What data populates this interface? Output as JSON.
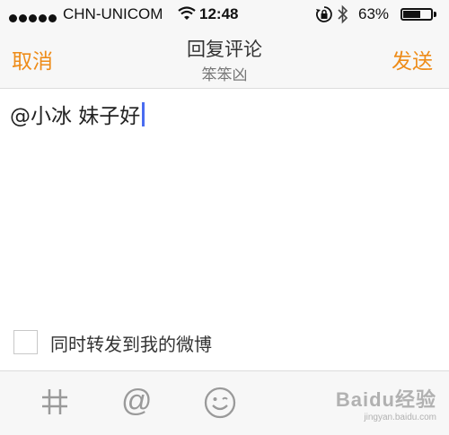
{
  "status_bar": {
    "carrier": "CHN-UNICOM",
    "time": "12:48",
    "battery_percent": "63%",
    "battery_level": 0.63,
    "icons": [
      "signal-dots-icon",
      "wifi-icon",
      "rotation-lock-icon",
      "bluetooth-icon",
      "battery-icon"
    ]
  },
  "nav": {
    "cancel_label": "取消",
    "title": "回复评论",
    "subtitle": "笨笨凶",
    "send_label": "发送"
  },
  "compose": {
    "text": "@小冰 妹子好"
  },
  "repost": {
    "label": "同时转发到我的微博",
    "checked": false
  },
  "toolbar": {
    "at_glyph": "@",
    "icons": [
      "hashtag-icon",
      "mention-icon",
      "emoji-icon"
    ]
  },
  "watermark": {
    "main": "Baidu经验",
    "sub": "jingyan.baidu.com"
  },
  "colors": {
    "accent": "#ee8c19",
    "caret": "#4a6cf0",
    "bar_bg": "#f7f7f7",
    "icon_gray": "#9a9a9a"
  }
}
